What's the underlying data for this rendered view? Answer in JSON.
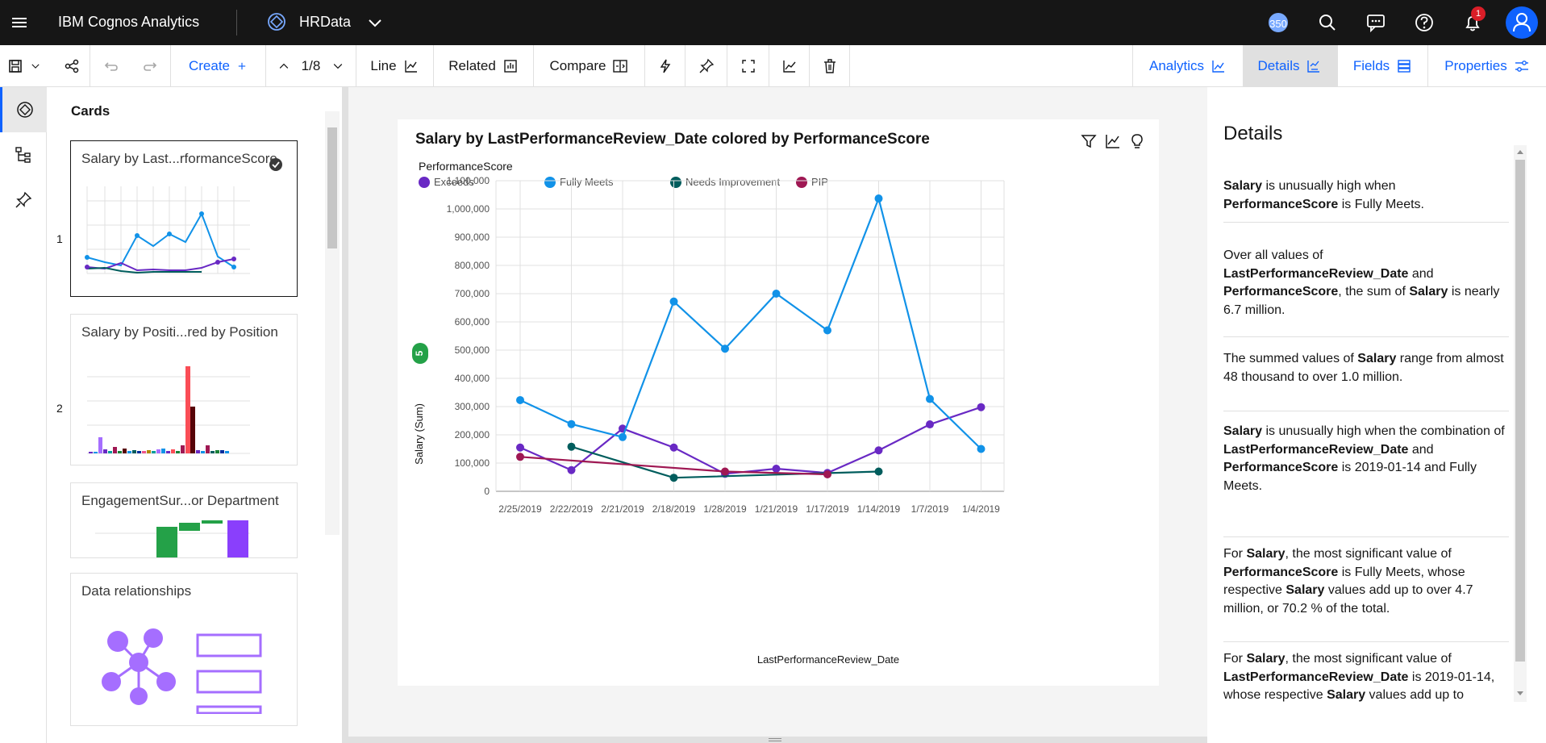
{
  "header": {
    "brand": "IBM Cognos Analytics",
    "datasource": "HRData",
    "counter_badge": "350",
    "notification_count": "1"
  },
  "toolbar": {
    "create": "Create",
    "page": "1/8",
    "line": "Line",
    "related": "Related",
    "compare": "Compare",
    "analytics": "Analytics",
    "details": "Details",
    "fields": "Fields",
    "properties": "Properties"
  },
  "cards_panel": {
    "title": "Cards",
    "cards": [
      {
        "title": "Salary by Last...rformanceScore",
        "number": "1"
      },
      {
        "title": "Salary by Positi...red by Position",
        "number": "2"
      },
      {
        "title": "EngagementSur...or Department",
        "number": ""
      },
      {
        "title": "Data relationships",
        "number": ""
      }
    ]
  },
  "chart_card": {
    "title": "Salary by LastPerformanceReview_Date colored by PerformanceScore",
    "legend_title": "PerformanceScore",
    "insight_count": "5"
  },
  "chart_data": {
    "type": "line",
    "title": "Salary by LastPerformanceReview_Date colored by PerformanceScore",
    "xlabel": "LastPerformanceReview_Date",
    "ylabel": "Salary (Sum)",
    "ylim": [
      0,
      1100000
    ],
    "yticks": [
      0,
      100000,
      200000,
      300000,
      400000,
      500000,
      600000,
      700000,
      800000,
      900000,
      1000000,
      1100000
    ],
    "ytick_labels": [
      "0",
      "100,000",
      "200,000",
      "300,000",
      "400,000",
      "500,000",
      "600,000",
      "700,000",
      "800,000",
      "900,000",
      "1,000,000",
      "1,100,000"
    ],
    "categories": [
      "2/25/2019",
      "2/22/2019",
      "2/21/2019",
      "2/18/2019",
      "1/28/2019",
      "1/21/2019",
      "1/17/2019",
      "1/14/2019",
      "1/7/2019",
      "1/4/2019"
    ],
    "grid": true,
    "legend_position": "top-left",
    "series": [
      {
        "name": "Exceeds",
        "color": "#6929c4",
        "values": [
          155000,
          75000,
          222000,
          155000,
          62000,
          80000,
          65000,
          145000,
          237000,
          298000
        ]
      },
      {
        "name": "Fully Meets",
        "color": "#1192e8",
        "values": [
          323000,
          238000,
          192000,
          672000,
          505000,
          700000,
          570000,
          1037000,
          327000,
          150000
        ]
      },
      {
        "name": "Needs Improvement",
        "color": "#005d5d",
        "values": [
          null,
          158000,
          null,
          48000,
          null,
          null,
          null,
          70000,
          null,
          null
        ]
      },
      {
        "name": "PIP",
        "color": "#9f1853",
        "values": [
          122000,
          null,
          null,
          null,
          70000,
          null,
          60000,
          null,
          null,
          null
        ]
      }
    ]
  },
  "details": {
    "title": "Details",
    "insights": [
      [
        {
          "b": true,
          "t": "Salary"
        },
        {
          "t": " is unusually high when "
        },
        {
          "b": true,
          "t": "PerformanceScore"
        },
        {
          "t": " is Fully Meets."
        }
      ],
      [
        {
          "t": "Over all values of "
        },
        {
          "b": true,
          "t": "LastPerformanceReview_Date"
        },
        {
          "t": " and "
        },
        {
          "b": true,
          "t": "PerformanceScore"
        },
        {
          "t": ", the sum of "
        },
        {
          "b": true,
          "t": "Salary"
        },
        {
          "t": " is nearly 6.7 million."
        }
      ],
      [
        {
          "t": "The summed values of "
        },
        {
          "b": true,
          "t": "Salary"
        },
        {
          "t": " range from almost 48 thousand to over 1.0 million."
        }
      ],
      [
        {
          "b": true,
          "t": "Salary"
        },
        {
          "t": " is unusually high when the combination of "
        },
        {
          "b": true,
          "t": "LastPerformanceReview_Date"
        },
        {
          "t": " and "
        },
        {
          "b": true,
          "t": "PerformanceScore"
        },
        {
          "t": " is 2019-01-14 and Fully Meets."
        }
      ],
      [
        {
          "t": "For "
        },
        {
          "b": true,
          "t": "Salary"
        },
        {
          "t": ", the most significant value of "
        },
        {
          "b": true,
          "t": "PerformanceScore"
        },
        {
          "t": " is Fully Meets, whose respective "
        },
        {
          "b": true,
          "t": "Salary"
        },
        {
          "t": " values add up to over 4.7 million, or 70.2 % of the total."
        }
      ],
      [
        {
          "t": "For "
        },
        {
          "b": true,
          "t": "Salary"
        },
        {
          "t": ", the most significant value of "
        },
        {
          "b": true,
          "t": "LastPerformanceReview_Date"
        },
        {
          "t": " is 2019-01-14, whose respective "
        },
        {
          "b": true,
          "t": "Salary"
        },
        {
          "t": " values add up to"
        }
      ]
    ]
  }
}
